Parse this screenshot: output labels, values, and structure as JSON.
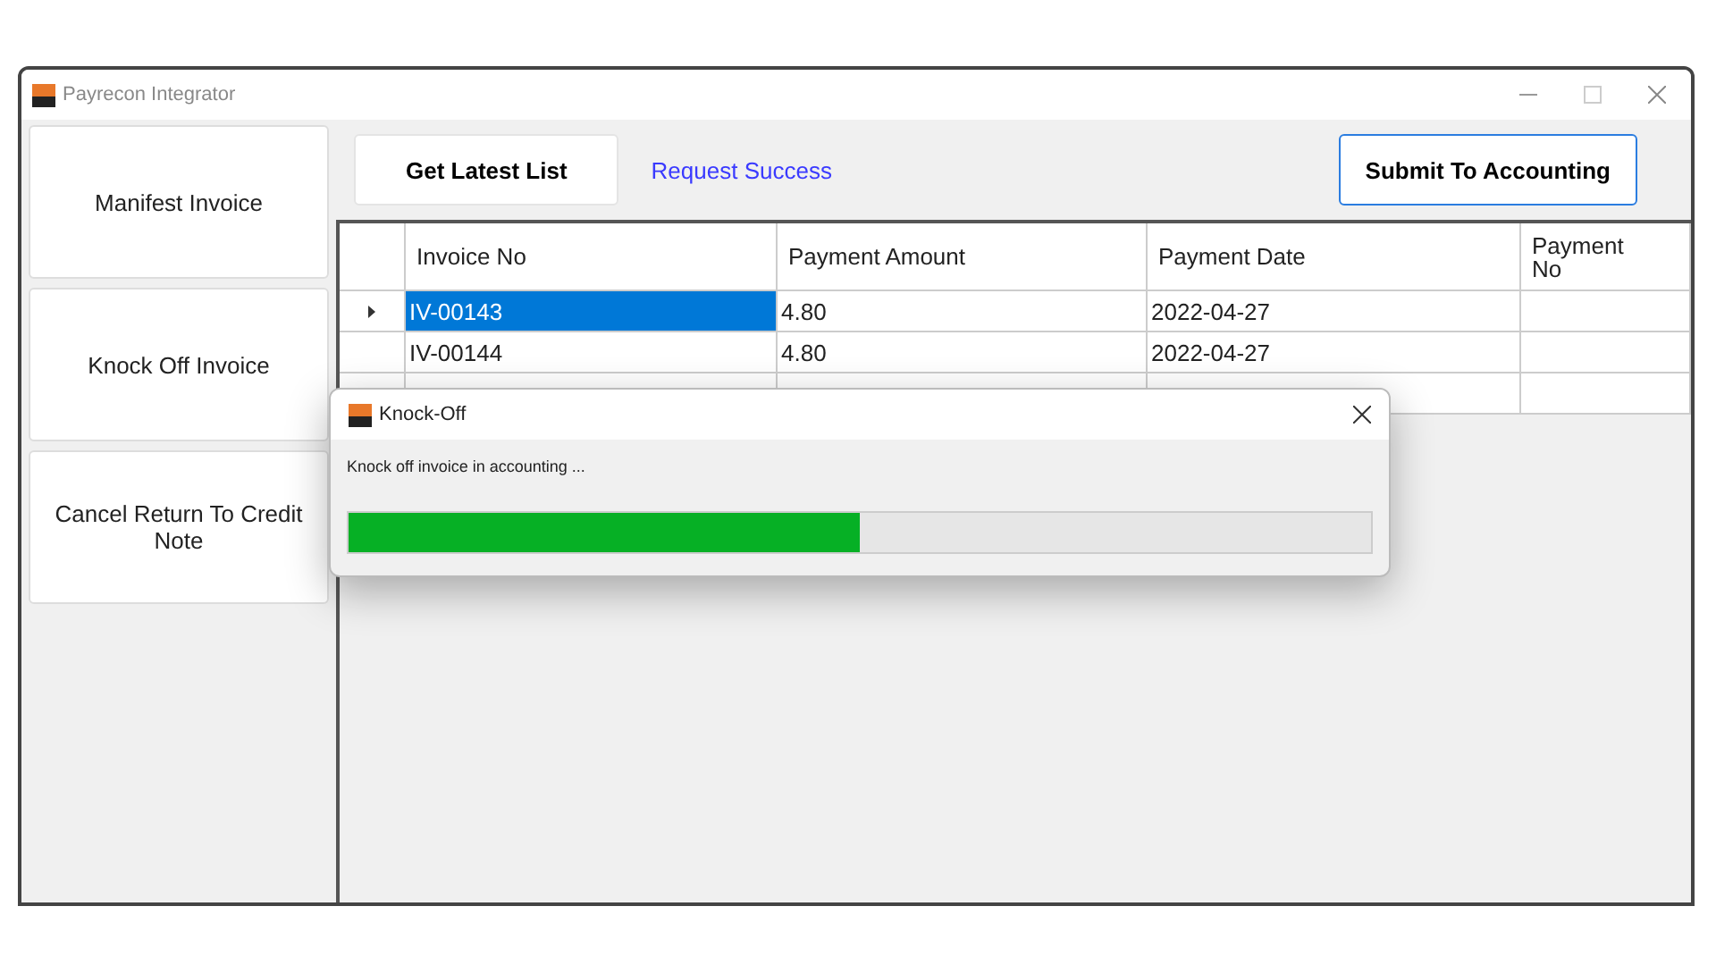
{
  "window": {
    "title": "Payrecon Integrator"
  },
  "sidebar": {
    "items": [
      {
        "label": "Manifest Invoice"
      },
      {
        "label": "Knock Off Invoice"
      },
      {
        "label": "Cancel Return To Credit Note"
      }
    ]
  },
  "toolbar": {
    "refresh_button": "Get Latest List",
    "status": "Request Success",
    "submit_button": "Submit To Accounting"
  },
  "table": {
    "columns": [
      "Invoice No",
      "Payment Amount",
      "Payment Date",
      "Payment No"
    ],
    "rows": [
      {
        "selected": true,
        "cells": [
          "IV-00143",
          "4.80",
          "2022-04-27",
          ""
        ]
      },
      {
        "selected": false,
        "cells": [
          "IV-00144",
          "4.80",
          "2022-04-27",
          ""
        ]
      },
      {
        "selected": false,
        "cells": [
          "",
          "",
          "",
          ""
        ]
      }
    ]
  },
  "dialog": {
    "title": "Knock-Off",
    "message": "Knock off invoice in accounting ...",
    "level": 0.5
  }
}
